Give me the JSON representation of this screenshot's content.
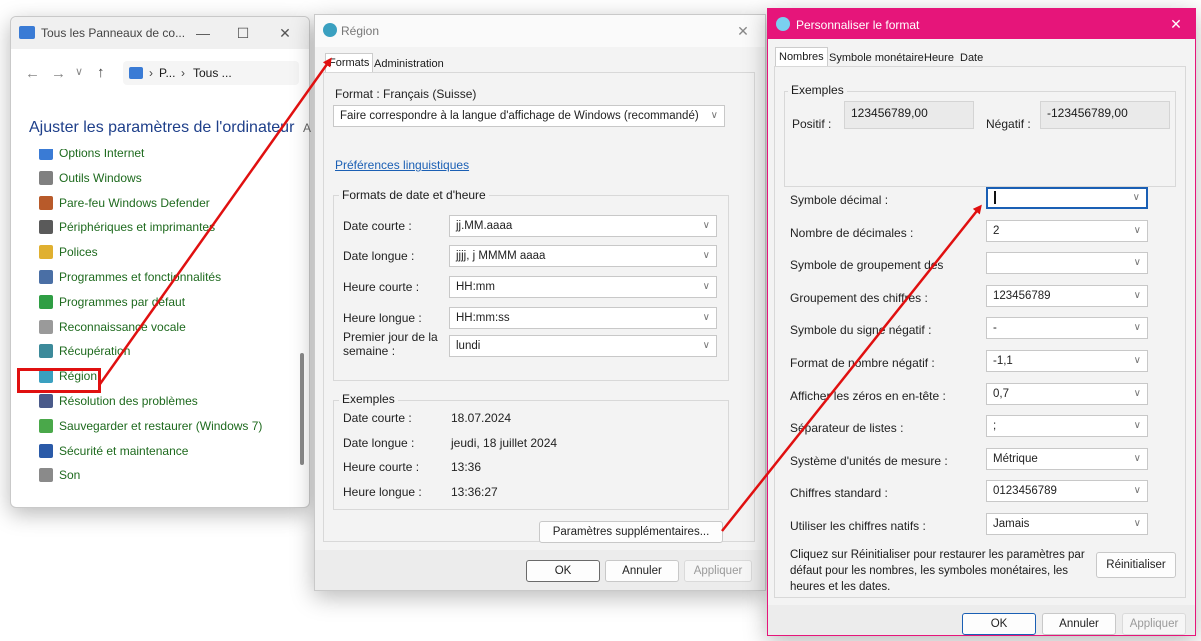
{
  "control_panel": {
    "title": "Tous les Panneaux de co...",
    "breadcrumb_p": "P...",
    "breadcrumb_tous": "Tous ...",
    "heading": "Ajuster les paramètres de l'ordinateur",
    "heading_clip": "A",
    "items": [
      {
        "label": "Options Internet",
        "color": "#3a7bd5"
      },
      {
        "label": "Outils Windows",
        "color": "#808080"
      },
      {
        "label": "Pare-feu Windows Defender",
        "color": "#b85a2a"
      },
      {
        "label": "Périphériques et imprimantes",
        "color": "#5a5a5a"
      },
      {
        "label": "Polices",
        "color": "#e0b030"
      },
      {
        "label": "Programmes et fonctionnalités",
        "color": "#4a6fa5"
      },
      {
        "label": "Programmes par défaut",
        "color": "#2f9e44"
      },
      {
        "label": "Reconnaissance vocale",
        "color": "#9a9a9a"
      },
      {
        "label": "Récupération",
        "color": "#3c8a9a"
      },
      {
        "label": "Région",
        "color": "#3aa0c0"
      },
      {
        "label": "Résolution des problèmes",
        "color": "#4a5a8a"
      },
      {
        "label": "Sauvegarder et restaurer (Windows 7)",
        "color": "#4aa84a"
      },
      {
        "label": "Sécurité et maintenance",
        "color": "#2a5aa8"
      },
      {
        "label": "Son",
        "color": "#8a8a8a"
      }
    ]
  },
  "region": {
    "title": "Région",
    "tabs": [
      "Formats",
      "Administration"
    ],
    "format_label": "Format : Français (Suisse)",
    "format_value": "Faire correspondre à la langue d'affichage de Windows (recommandé)",
    "link": "Préférences linguistiques",
    "group_label": "Formats de date et d'heure",
    "rows": [
      {
        "label": "Date courte :",
        "value": "jj.MM.aaaa"
      },
      {
        "label": "Date longue :",
        "value": "jjjj, j MMMM aaaa"
      },
      {
        "label": "Heure courte :",
        "value": "HH:mm"
      },
      {
        "label": "Heure longue :",
        "value": "HH:mm:ss"
      },
      {
        "label": "Premier jour de la semaine :",
        "value": "lundi"
      }
    ],
    "examples_label": "Exemples",
    "examples": [
      {
        "label": "Date courte :",
        "value": "18.07.2024"
      },
      {
        "label": "Date longue :",
        "value": "jeudi, 18 juillet 2024"
      },
      {
        "label": "Heure courte :",
        "value": "13:36"
      },
      {
        "label": "Heure longue :",
        "value": "13:36:27"
      }
    ],
    "extra_button": "Paramètres supplémentaires...",
    "ok": "OK",
    "cancel": "Annuler",
    "apply": "Appliquer"
  },
  "custom": {
    "title": "Personnaliser le format",
    "title_color": "#e6157a",
    "tabs": [
      "Nombres",
      "Symbole monétaire",
      "Heure",
      "Date"
    ],
    "examples_label": "Exemples",
    "positive_label": "Positif :",
    "positive_value": "123456789,00",
    "negative_label": "Négatif :",
    "negative_value": "-123456789,00",
    "rows": [
      {
        "label": "Symbole décimal :",
        "value": ""
      },
      {
        "label": "Nombre de décimales :",
        "value": "2"
      },
      {
        "label": "Symbole de groupement des",
        "value": ""
      },
      {
        "label": "Groupement des chiffres :",
        "value": "123456789"
      },
      {
        "label": "Symbole du signe négatif :",
        "value": "-"
      },
      {
        "label": "Format de nombre négatif :",
        "value": "-1,1"
      },
      {
        "label": "Afficher les zéros en en-tête :",
        "value": "0,7"
      },
      {
        "label": "Séparateur de listes :",
        "value": ";"
      },
      {
        "label": "Système d'unités de mesure :",
        "value": "Métrique"
      },
      {
        "label": "Chiffres standard :",
        "value": "0123456789"
      },
      {
        "label": "Utiliser les chiffres natifs :",
        "value": "Jamais"
      }
    ],
    "reset_text": "Cliquez sur Réinitialiser pour restaurer les paramètres par défaut pour les nombres, les symboles monétaires, les heures et les dates.",
    "reset_button": "Réinitialiser",
    "ok": "OK",
    "cancel": "Annuler",
    "apply": "Appliquer"
  },
  "annotation_color": "#e01010"
}
